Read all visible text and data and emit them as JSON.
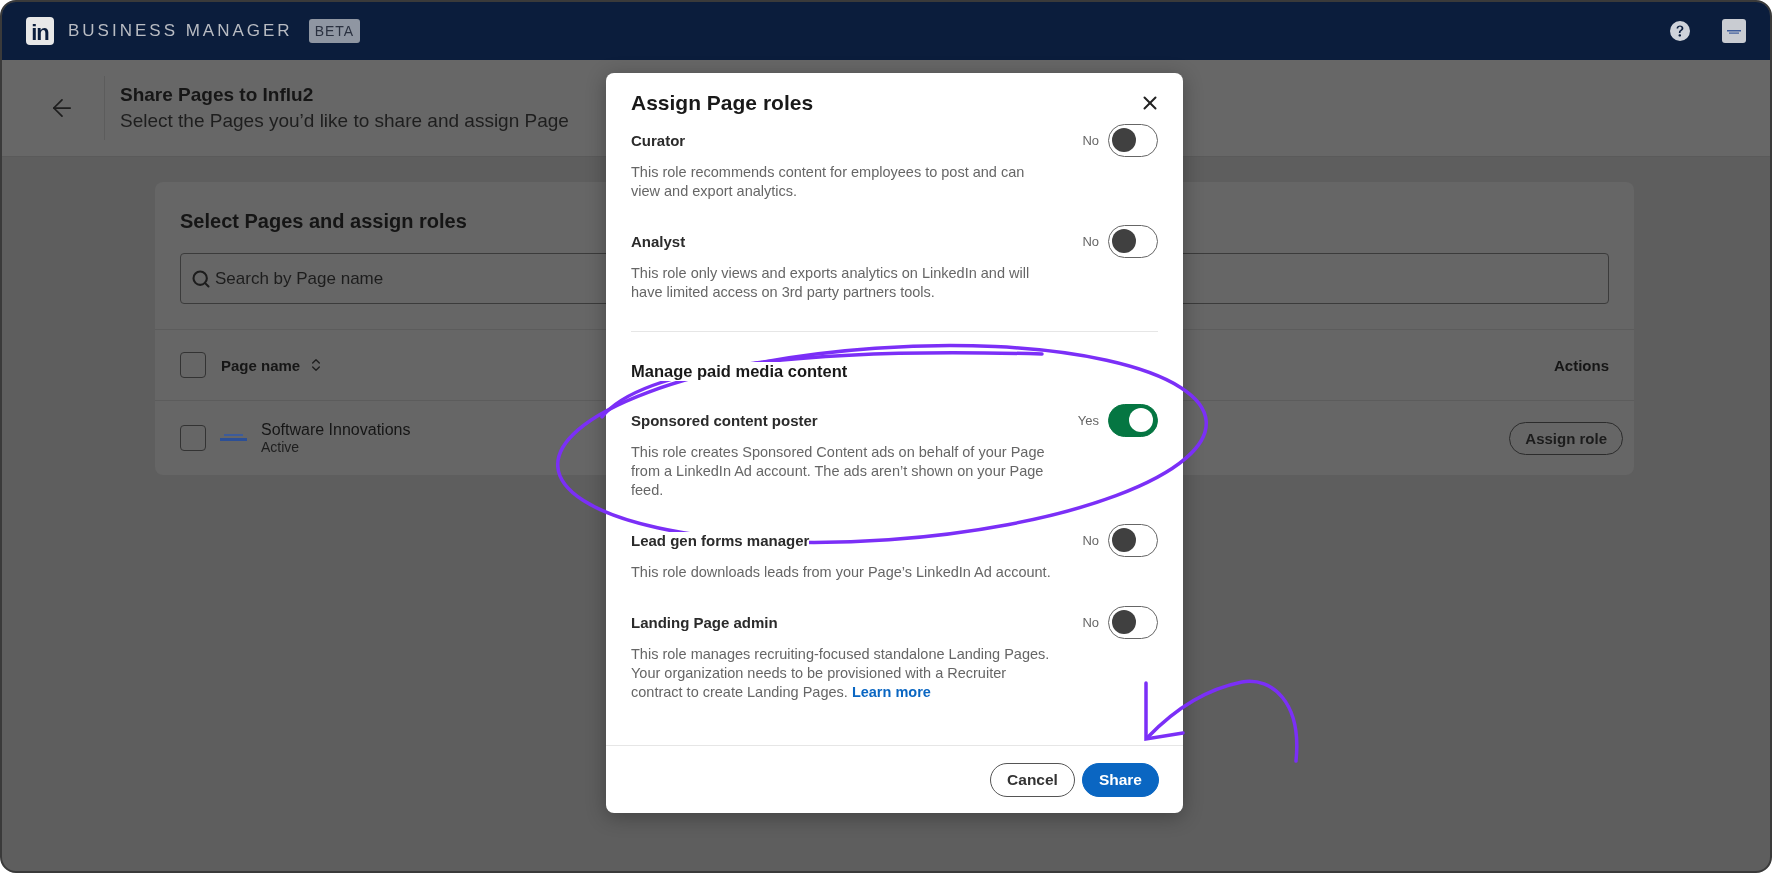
{
  "top_bar": {
    "logo_text": "in",
    "product": "BUSINESS MANAGER",
    "badge": "BETA"
  },
  "page_header": {
    "title": "Share Pages to Influ2",
    "subtitle": "Select the Pages you’d like to share and assign Page"
  },
  "card": {
    "title": "Select Pages and assign roles",
    "search": {
      "placeholder": "Search by Page name"
    },
    "table": {
      "columns": [
        "Page name",
        "Actions"
      ],
      "header_checked": false,
      "rows": [
        {
          "name": "Software Innovations",
          "status": "Active",
          "checked": false,
          "action": "Assign role"
        }
      ]
    }
  },
  "modal": {
    "title": "Assign Page roles",
    "groups": [
      {
        "roles": [
          {
            "name": "Curator",
            "on": false,
            "state_label": "No",
            "description": "This role recommends content for employees to post and can view and export analytics."
          },
          {
            "name": "Analyst",
            "on": false,
            "state_label": "No",
            "description": "This role only views and exports analytics on LinkedIn and will have limited access on 3rd party partners tools."
          }
        ]
      },
      {
        "heading": "Manage paid media content",
        "roles": [
          {
            "name": "Sponsored content poster",
            "on": true,
            "state_label": "Yes",
            "description": "This role creates Sponsored Content ads on behalf of your Page from a LinkedIn Ad account. The ads aren’t shown on your Page feed."
          },
          {
            "name": "Lead gen forms manager",
            "on": false,
            "state_label": "No",
            "description": "This role downloads leads from your Page’s LinkedIn Ad account."
          },
          {
            "name": "Landing Page admin",
            "on": false,
            "state_label": "No",
            "description": "This role manages recruiting-focused standalone Landing Pages. Your organization needs to be provisioned with a Recruiter contract to create Landing Pages.",
            "link": "Learn more"
          }
        ]
      }
    ],
    "buttons": [
      {
        "label": "Cancel",
        "kind": "secondary"
      },
      {
        "label": "Share",
        "kind": "primary"
      }
    ]
  }
}
